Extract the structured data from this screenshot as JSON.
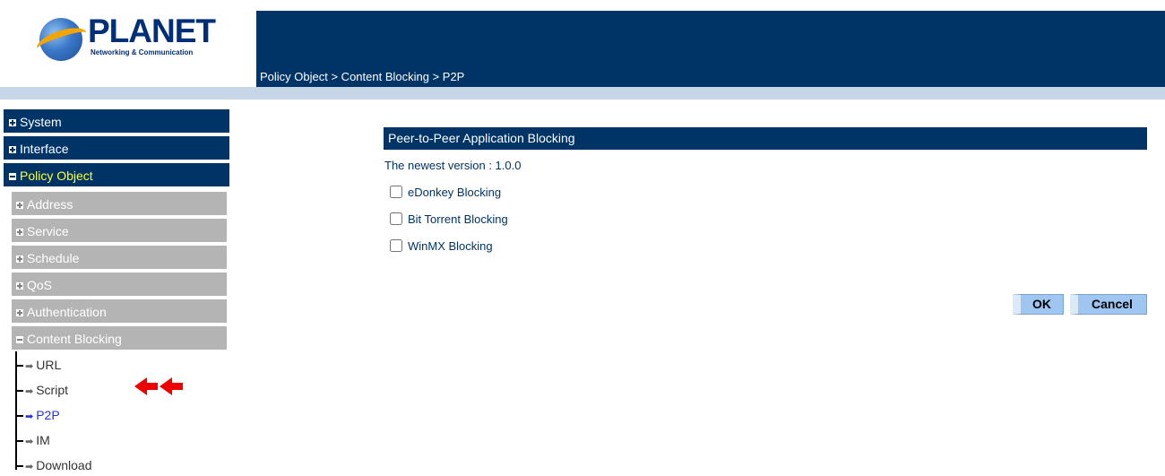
{
  "header": {
    "logo_text": "PLANET",
    "logo_subtitle": "Networking & Communication",
    "breadcrumb": "Policy Object > Content Blocking > P2P"
  },
  "sidebar": {
    "main_items": [
      {
        "label": "System",
        "expanded": false
      },
      {
        "label": "Interface",
        "expanded": false
      },
      {
        "label": "Policy Object",
        "expanded": true,
        "active": true
      }
    ],
    "sub_items": [
      {
        "label": "Address",
        "expanded": false
      },
      {
        "label": "Service",
        "expanded": false
      },
      {
        "label": "Schedule",
        "expanded": false
      },
      {
        "label": "QoS",
        "expanded": false
      },
      {
        "label": "Authentication",
        "expanded": false
      },
      {
        "label": "Content Blocking",
        "expanded": true
      }
    ],
    "tree_items": [
      {
        "label": "URL"
      },
      {
        "label": "Script"
      },
      {
        "label": "P2P",
        "current": true
      },
      {
        "label": "IM"
      },
      {
        "label": "Download"
      }
    ],
    "annotation_arrows": "🡐🡐"
  },
  "main": {
    "title": "Peer-to-Peer Application Blocking",
    "version": "The newest version : 1.0.0",
    "options": [
      {
        "label": "eDonkey Blocking",
        "checked": false
      },
      {
        "label": "Bit Torrent Blocking",
        "checked": false
      },
      {
        "label": "WinMX Blocking",
        "checked": false
      }
    ],
    "ok_label": "OK",
    "cancel_label": "Cancel"
  },
  "colors": {
    "header_bg": "#003466",
    "submenu_bg": "#b4b4b4",
    "active_text": "#ffff33",
    "button_bg": "#9ec6f0",
    "annotation": "#ee0000"
  }
}
